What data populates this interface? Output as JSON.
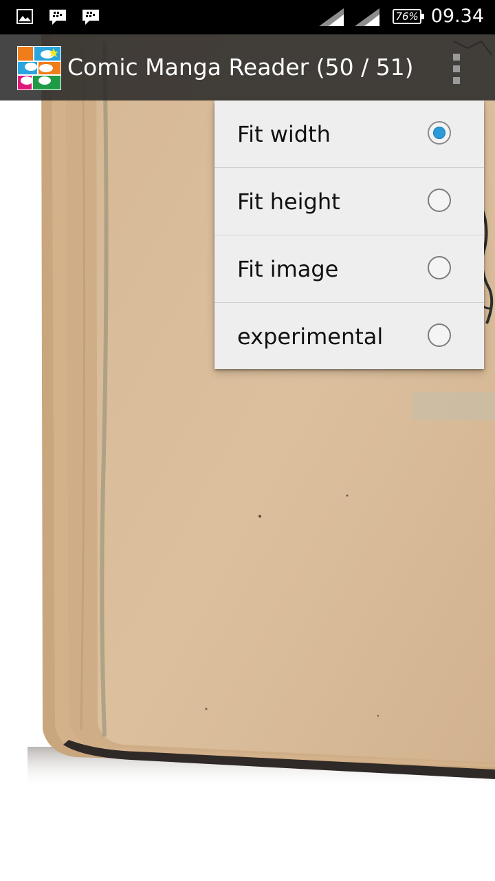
{
  "status_bar": {
    "time": "09.34",
    "battery_percent": "76%",
    "icons": [
      "image-icon",
      "bbm-icon",
      "bbm-icon",
      "signal-icon",
      "signal-icon",
      "battery-icon"
    ]
  },
  "action_bar": {
    "title": "Comic Manga Reader (50 / 51)",
    "logo_icon": "comic-manga-reader-logo-icon",
    "overflow_icon": "overflow-menu-icon"
  },
  "popup_menu": {
    "items": [
      {
        "label": "Fit width",
        "checked": true
      },
      {
        "label": "Fit height",
        "checked": false
      },
      {
        "label": "Fit image",
        "checked": false
      },
      {
        "label": "experimental",
        "checked": false
      }
    ]
  },
  "colors": {
    "radio_accent": "#2c9ad8",
    "menu_background": "#eeeeee",
    "action_bar": "#282828",
    "page_paper": "#d9bc99"
  }
}
